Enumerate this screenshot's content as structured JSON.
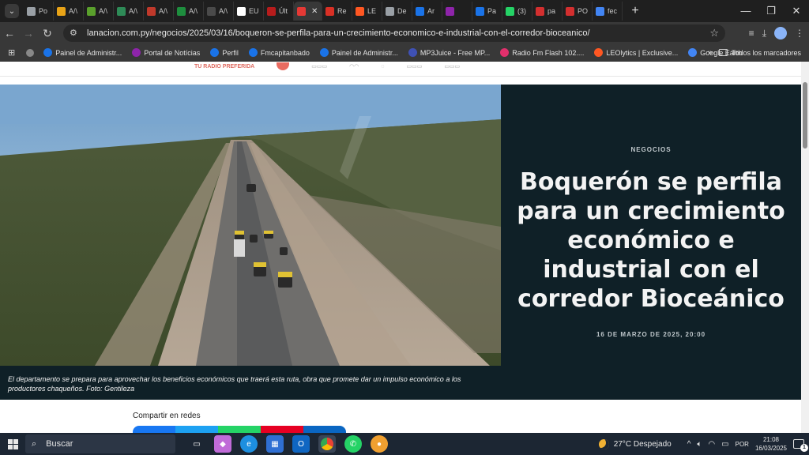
{
  "browser": {
    "tabs": [
      {
        "label": "Po",
        "color": "#9aa0a6"
      },
      {
        "label": "A/\\",
        "color": "#e8a317"
      },
      {
        "label": "A/\\",
        "color": "#5aa02c"
      },
      {
        "label": "A/\\",
        "color": "#2e8b57"
      },
      {
        "label": "A/\\",
        "color": "#c0392b"
      },
      {
        "label": "A/\\",
        "color": "#1e8e3e"
      },
      {
        "label": "A/\\",
        "color": "#4a4a4a"
      },
      {
        "label": "EU",
        "color": "#ffffff"
      },
      {
        "label": "Últ",
        "color": "#b71c1c"
      },
      {
        "label": "",
        "color": "#e53935",
        "active": true
      },
      {
        "label": "Re",
        "color": "#d93025"
      },
      {
        "label": "LE",
        "color": "#ff5722"
      },
      {
        "label": "De",
        "color": "#9aa0a6"
      },
      {
        "label": "Ar",
        "color": "#1a73e8"
      },
      {
        "label": "",
        "color": "#8e24aa"
      },
      {
        "label": "Pa",
        "color": "#1a73e8"
      },
      {
        "label": "(3)",
        "color": "#25d366"
      },
      {
        "label": "pa",
        "color": "#d32f2f"
      },
      {
        "label": "PO",
        "color": "#d32f2f"
      },
      {
        "label": "fec",
        "color": "#4285f4"
      }
    ],
    "url": "lanacion.com.py/negocios/2025/03/16/boqueron-se-perfila-para-un-crecimiento-economico-e-industrial-con-el-corredor-bioceanico/",
    "bookmarks": [
      {
        "label": "Painel de Administr...",
        "color": "#1a73e8"
      },
      {
        "label": "Portal de Notícias",
        "color": "#8e24aa"
      },
      {
        "label": "Perfil",
        "color": "#1a73e8"
      },
      {
        "label": "Fmcapitanbado",
        "color": "#1a73e8"
      },
      {
        "label": "Painel de Administr...",
        "color": "#1a73e8"
      },
      {
        "label": "MP3Juice - Free MP...",
        "color": "#3f51b5"
      },
      {
        "label": "Radio Fm Flash 102....",
        "color": "#e1306c"
      },
      {
        "label": "LEOlytics | Exclusive...",
        "color": "#ff5722"
      },
      {
        "label": "Google Earth",
        "color": "#4285f4"
      }
    ],
    "bookmarks_more": "»",
    "all_bookmarks": "Todos los marcadores"
  },
  "page": {
    "partners": {
      "radio": "TU RADIO PREFERIDA"
    },
    "article": {
      "section": "NEGOCIOS",
      "headline": "Boquerón se perfila para un crecimiento económico e industrial con el corredor Bioceánico",
      "date": "16 DE MARZO DE 2025, 20:00",
      "caption": "El departamento se prepara para aprovechar los beneficios económicos que traerá esta ruta, obra que promete dar un impulso económico a los productores chaqueños. Foto: Gentileza"
    },
    "share_label": "Compartir en redes",
    "share_colors": [
      "#1877f2",
      "#1da1f2",
      "#25d366",
      "#e60023",
      "#0a66c2"
    ]
  },
  "taskbar": {
    "search_placeholder": "Buscar",
    "weather": "27°C  Despejado",
    "language": "POR",
    "time": "21:08",
    "date": "16/03/2025",
    "notifications": "1"
  }
}
